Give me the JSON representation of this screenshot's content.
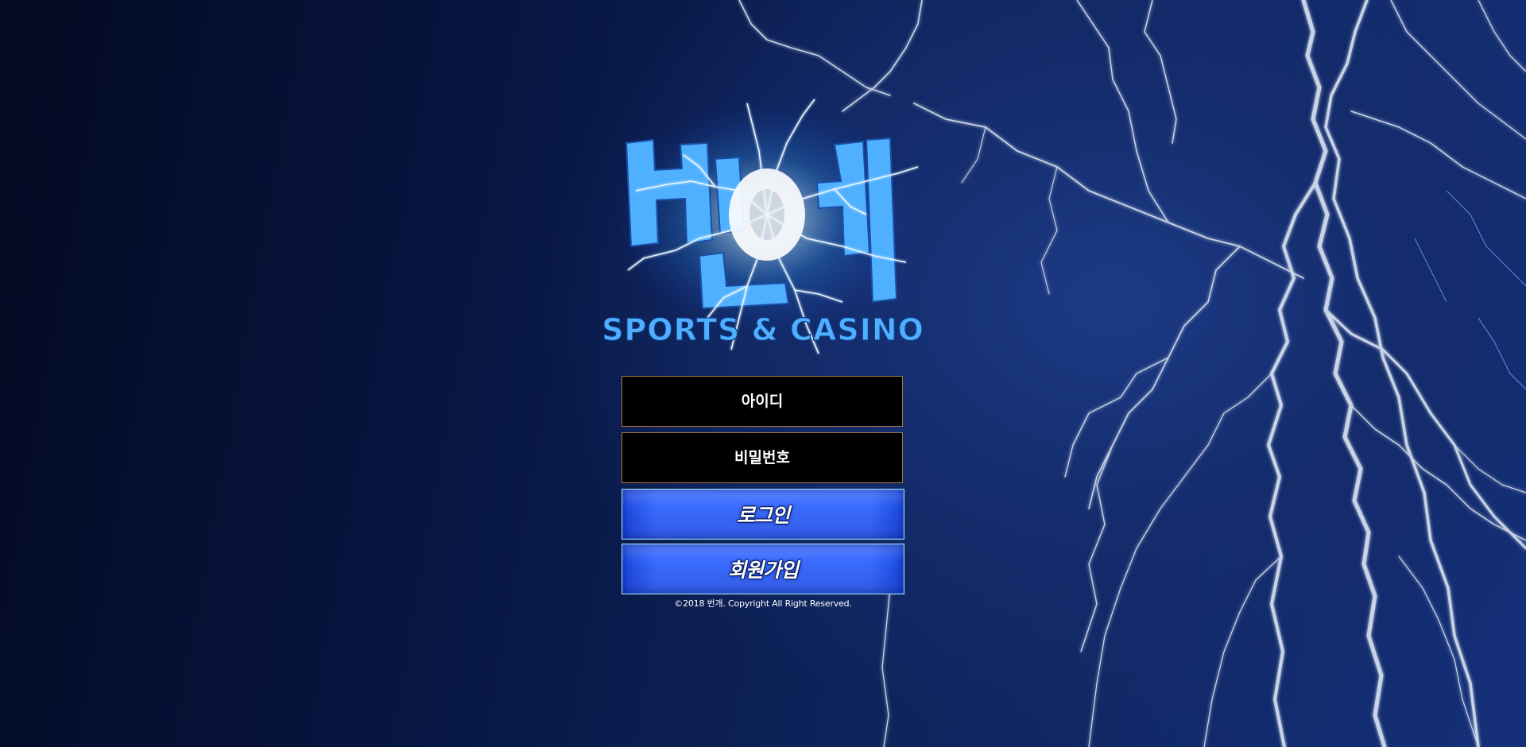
{
  "logo": {
    "title": "번개",
    "subtitle": "SPORTS & CASINO",
    "accent_color": "#4fb0ff"
  },
  "login_form": {
    "id_placeholder": "아이디",
    "password_placeholder": "비밀번호",
    "login_label": "로그인",
    "signup_label": "회원가입",
    "button_color": "#3a6bff",
    "field_border_color": "#a57a3a"
  },
  "footer": {
    "copyright": "©2018 번개. Copyright All Right Reserved."
  }
}
